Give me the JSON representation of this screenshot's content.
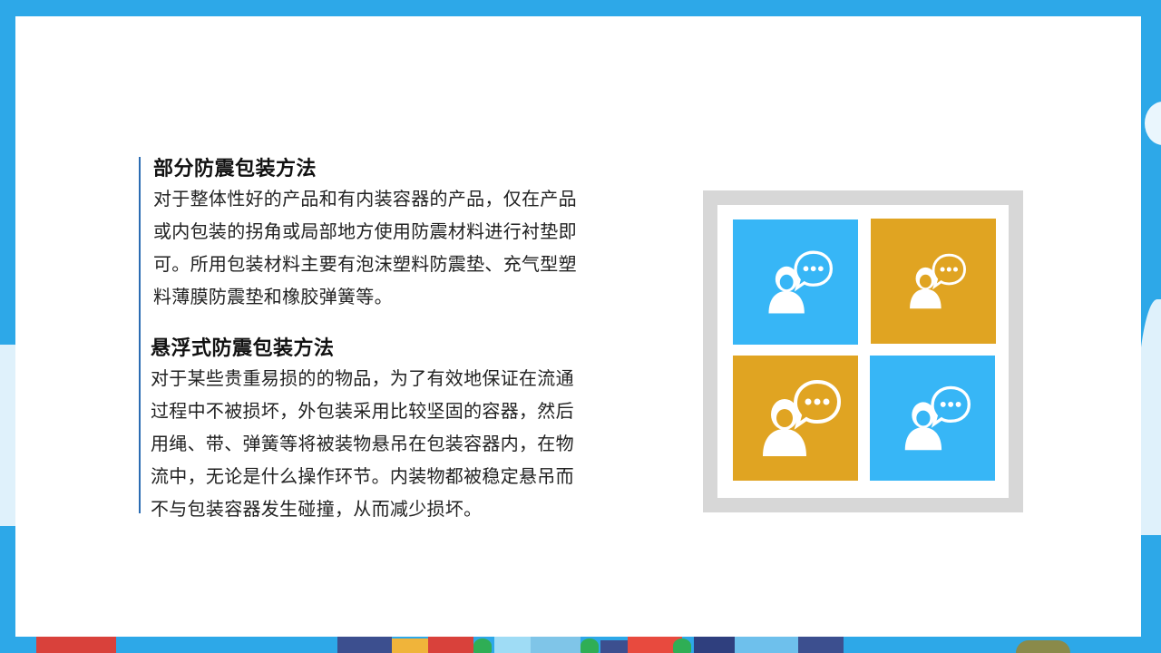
{
  "sections": [
    {
      "heading": "部分防震包装方法",
      "lines": [
        "对于整体性好的产品和有内装容器的产品，仅在产品",
        "或内包装的拐角或局部地方使用防震材料进行衬垫即",
        "可。所用包装材料主要有泡沫塑料防震垫、充气型塑",
        "料薄膜防震垫和橡胶弹簧等。"
      ]
    },
    {
      "heading": "悬浮式防震包装方法",
      "lines": [
        "对于某些贵重易损的的物品，为了有效地保证在流通",
        "过程中不被损坏，外包装采用比较坚固的容器，然后",
        "用绳、带、弹簧等将被装物悬吊在包装容器内，在物",
        "流中，无论是什么操作环节。内装物都被稳定悬吊而",
        "不与包装容器发生碰撞，从而减少损坏。"
      ]
    }
  ],
  "tiles": [
    {
      "icon": "person-chat-icon",
      "color": "#37b6f6"
    },
    {
      "icon": "person-chat-icon",
      "color": "#e0a422"
    },
    {
      "icon": "person-chat-icon",
      "color": "#e0a422"
    },
    {
      "icon": "person-chat-icon",
      "color": "#37b6f6"
    }
  ],
  "colors": {
    "frame": "#2da8e8",
    "accent_line": "#2b6cb3",
    "panel_border": "#d7d7d7",
    "tile_blue": "#37b6f6",
    "tile_gold": "#e0a422"
  }
}
